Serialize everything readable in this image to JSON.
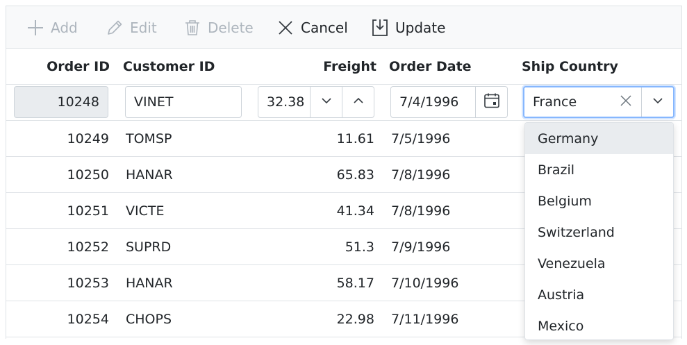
{
  "toolbar": {
    "add_label": "Add",
    "edit_label": "Edit",
    "delete_label": "Delete",
    "cancel_label": "Cancel",
    "update_label": "Update"
  },
  "columns": {
    "order_id": "Order ID",
    "customer_id": "Customer ID",
    "freight": "Freight",
    "order_date": "Order Date",
    "ship_country": "Ship Country"
  },
  "edit_row": {
    "order_id": "10248",
    "customer_id": "VINET",
    "freight": "32.38",
    "order_date": "7/4/1996",
    "ship_country": "France"
  },
  "rows": [
    {
      "order_id": "10249",
      "customer_id": "TOMSP",
      "freight": "11.61",
      "order_date": "7/5/1996"
    },
    {
      "order_id": "10250",
      "customer_id": "HANAR",
      "freight": "65.83",
      "order_date": "7/8/1996"
    },
    {
      "order_id": "10251",
      "customer_id": "VICTE",
      "freight": "41.34",
      "order_date": "7/8/1996"
    },
    {
      "order_id": "10252",
      "customer_id": "SUPRD",
      "freight": "51.3",
      "order_date": "7/9/1996"
    },
    {
      "order_id": "10253",
      "customer_id": "HANAR",
      "freight": "58.17",
      "order_date": "7/10/1996"
    },
    {
      "order_id": "10254",
      "customer_id": "CHOPS",
      "freight": "22.98",
      "order_date": "7/11/1996"
    }
  ],
  "country_options": [
    "Germany",
    "Brazil",
    "Belgium",
    "Switzerland",
    "Venezuela",
    "Austria",
    "Mexico"
  ],
  "icons": {
    "add": "plus-icon",
    "edit": "pencil-icon",
    "delete": "trash-icon",
    "cancel": "close-icon",
    "update": "save-icon"
  },
  "colors": {
    "disabled": "#adb5bd",
    "focus_border": "#86b7fe",
    "readonly_bg": "#e9ecef",
    "border": "#dee2e6"
  }
}
